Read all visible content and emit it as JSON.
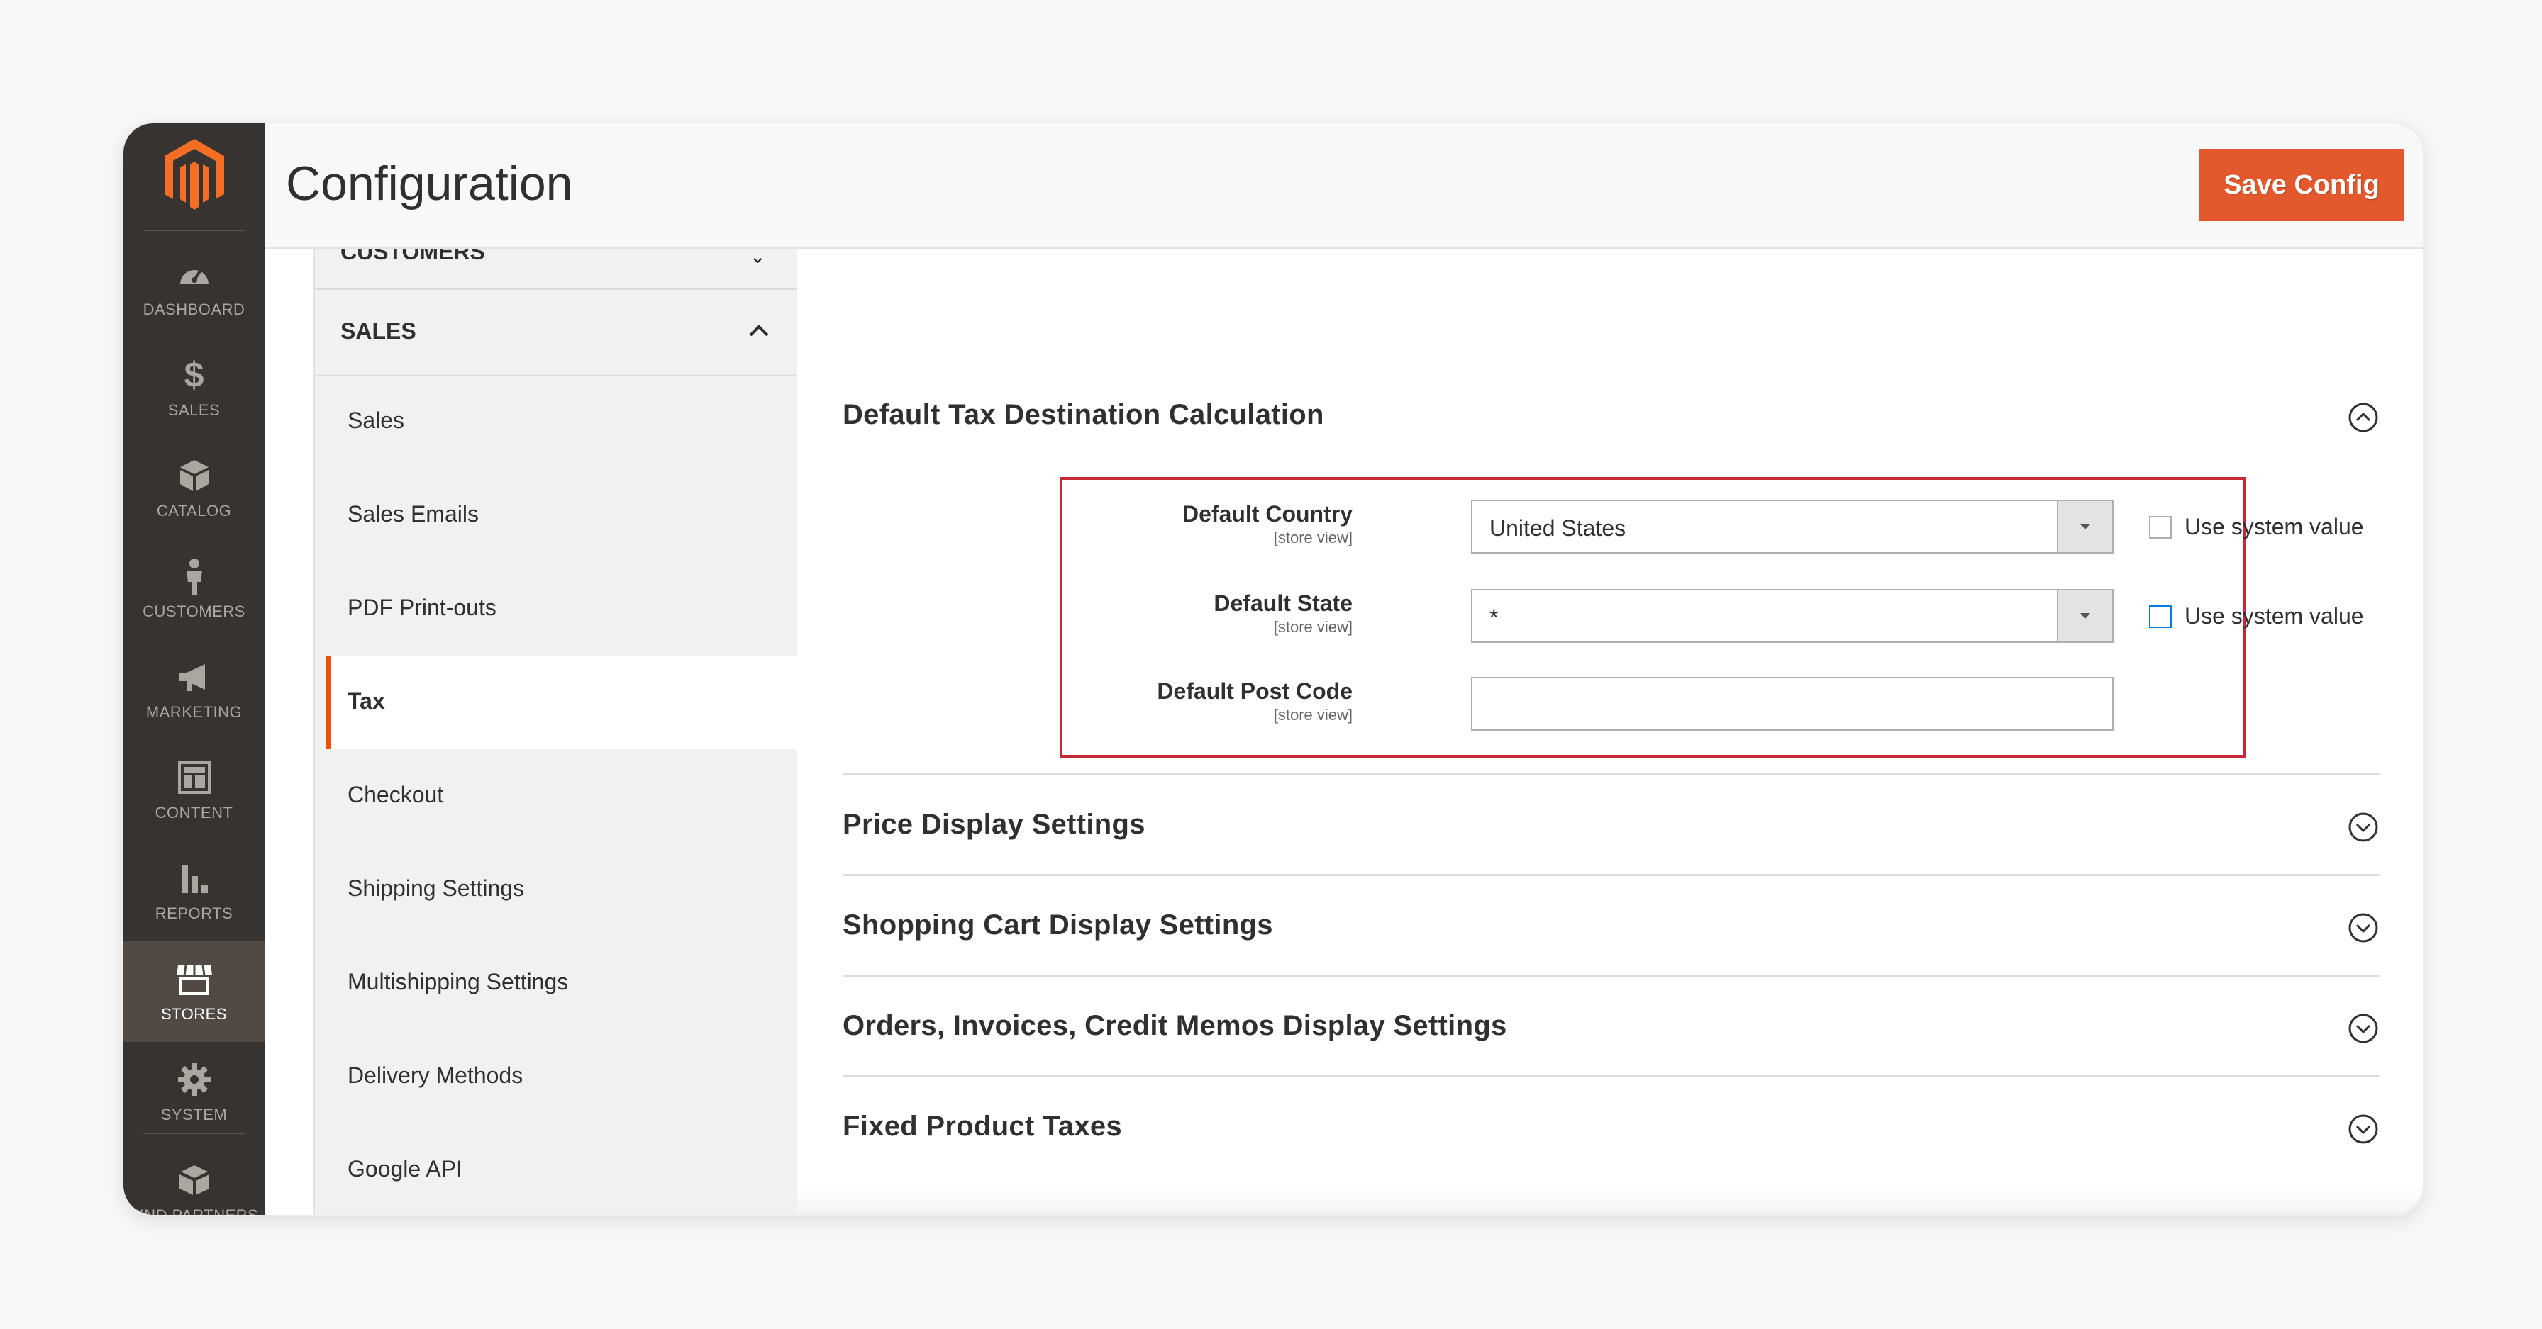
{
  "header": {
    "title": "Configuration",
    "save_label": "Save Config"
  },
  "nav": {
    "items": [
      {
        "label": "DASHBOARD",
        "icon": "dashboard-icon"
      },
      {
        "label": "SALES",
        "icon": "dollar-icon"
      },
      {
        "label": "CATALOG",
        "icon": "cube-icon"
      },
      {
        "label": "CUSTOMERS",
        "icon": "person-icon"
      },
      {
        "label": "MARKETING",
        "icon": "megaphone-icon"
      },
      {
        "label": "CONTENT",
        "icon": "layout-icon"
      },
      {
        "label": "REPORTS",
        "icon": "bar-chart-icon"
      },
      {
        "label": "STORES",
        "icon": "store-icon"
      },
      {
        "label": "SYSTEM",
        "icon": "gear-icon"
      },
      {
        "label": "FIND PARTNERS",
        "icon": "boxes-icon"
      }
    ],
    "active": "STORES"
  },
  "tabs": {
    "customers_label": "CUSTOMERS",
    "sales_label": "SALES",
    "items": [
      "Sales",
      "Sales Emails",
      "PDF Print-outs",
      "Tax",
      "Checkout",
      "Shipping Settings",
      "Multishipping Settings",
      "Delivery Methods",
      "Google API"
    ],
    "active": "Tax"
  },
  "main": {
    "section_open": "Default Tax Destination Calculation",
    "fields": [
      {
        "label": "Default Country",
        "scope": "[store view]",
        "value": "United States",
        "checkbox": "Use system value"
      },
      {
        "label": "Default State",
        "scope": "[store view]",
        "value": "*",
        "checkbox": "Use system value"
      },
      {
        "label": "Default Post Code",
        "scope": "[store view]",
        "value": ""
      }
    ],
    "sections": [
      "Price Display Settings",
      "Shopping Cart Display Settings",
      "Orders, Invoices, Credit Memos Display Settings",
      "Fixed Product Taxes"
    ]
  },
  "colors": {
    "accent": "#e3582d",
    "nav_bg": "#373330",
    "highlight": "#c62a36",
    "active_tab_border": "#eb5202"
  }
}
